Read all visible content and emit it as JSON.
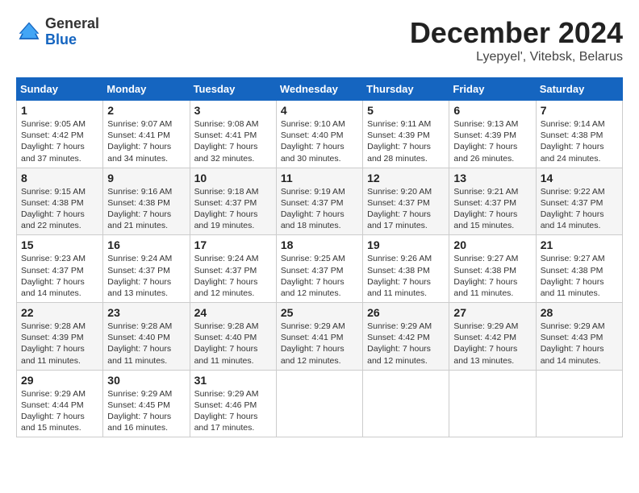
{
  "header": {
    "logo_line1": "General",
    "logo_line2": "Blue",
    "month_title": "December 2024",
    "subtitle": "Lyepyel', Vitebsk, Belarus"
  },
  "days_of_week": [
    "Sunday",
    "Monday",
    "Tuesday",
    "Wednesday",
    "Thursday",
    "Friday",
    "Saturday"
  ],
  "weeks": [
    [
      {
        "day": "1",
        "sunrise": "9:05 AM",
        "sunset": "4:42 PM",
        "daylight": "7 hours and 37 minutes."
      },
      {
        "day": "2",
        "sunrise": "9:07 AM",
        "sunset": "4:41 PM",
        "daylight": "7 hours and 34 minutes."
      },
      {
        "day": "3",
        "sunrise": "9:08 AM",
        "sunset": "4:41 PM",
        "daylight": "7 hours and 32 minutes."
      },
      {
        "day": "4",
        "sunrise": "9:10 AM",
        "sunset": "4:40 PM",
        "daylight": "7 hours and 30 minutes."
      },
      {
        "day": "5",
        "sunrise": "9:11 AM",
        "sunset": "4:39 PM",
        "daylight": "7 hours and 28 minutes."
      },
      {
        "day": "6",
        "sunrise": "9:13 AM",
        "sunset": "4:39 PM",
        "daylight": "7 hours and 26 minutes."
      },
      {
        "day": "7",
        "sunrise": "9:14 AM",
        "sunset": "4:38 PM",
        "daylight": "7 hours and 24 minutes."
      }
    ],
    [
      {
        "day": "8",
        "sunrise": "9:15 AM",
        "sunset": "4:38 PM",
        "daylight": "7 hours and 22 minutes."
      },
      {
        "day": "9",
        "sunrise": "9:16 AM",
        "sunset": "4:38 PM",
        "daylight": "7 hours and 21 minutes."
      },
      {
        "day": "10",
        "sunrise": "9:18 AM",
        "sunset": "4:37 PM",
        "daylight": "7 hours and 19 minutes."
      },
      {
        "day": "11",
        "sunrise": "9:19 AM",
        "sunset": "4:37 PM",
        "daylight": "7 hours and 18 minutes."
      },
      {
        "day": "12",
        "sunrise": "9:20 AM",
        "sunset": "4:37 PM",
        "daylight": "7 hours and 17 minutes."
      },
      {
        "day": "13",
        "sunrise": "9:21 AM",
        "sunset": "4:37 PM",
        "daylight": "7 hours and 15 minutes."
      },
      {
        "day": "14",
        "sunrise": "9:22 AM",
        "sunset": "4:37 PM",
        "daylight": "7 hours and 14 minutes."
      }
    ],
    [
      {
        "day": "15",
        "sunrise": "9:23 AM",
        "sunset": "4:37 PM",
        "daylight": "7 hours and 14 minutes."
      },
      {
        "day": "16",
        "sunrise": "9:24 AM",
        "sunset": "4:37 PM",
        "daylight": "7 hours and 13 minutes."
      },
      {
        "day": "17",
        "sunrise": "9:24 AM",
        "sunset": "4:37 PM",
        "daylight": "7 hours and 12 minutes."
      },
      {
        "day": "18",
        "sunrise": "9:25 AM",
        "sunset": "4:37 PM",
        "daylight": "7 hours and 12 minutes."
      },
      {
        "day": "19",
        "sunrise": "9:26 AM",
        "sunset": "4:38 PM",
        "daylight": "7 hours and 11 minutes."
      },
      {
        "day": "20",
        "sunrise": "9:27 AM",
        "sunset": "4:38 PM",
        "daylight": "7 hours and 11 minutes."
      },
      {
        "day": "21",
        "sunrise": "9:27 AM",
        "sunset": "4:38 PM",
        "daylight": "7 hours and 11 minutes."
      }
    ],
    [
      {
        "day": "22",
        "sunrise": "9:28 AM",
        "sunset": "4:39 PM",
        "daylight": "7 hours and 11 minutes."
      },
      {
        "day": "23",
        "sunrise": "9:28 AM",
        "sunset": "4:40 PM",
        "daylight": "7 hours and 11 minutes."
      },
      {
        "day": "24",
        "sunrise": "9:28 AM",
        "sunset": "4:40 PM",
        "daylight": "7 hours and 11 minutes."
      },
      {
        "day": "25",
        "sunrise": "9:29 AM",
        "sunset": "4:41 PM",
        "daylight": "7 hours and 12 minutes."
      },
      {
        "day": "26",
        "sunrise": "9:29 AM",
        "sunset": "4:42 PM",
        "daylight": "7 hours and 12 minutes."
      },
      {
        "day": "27",
        "sunrise": "9:29 AM",
        "sunset": "4:42 PM",
        "daylight": "7 hours and 13 minutes."
      },
      {
        "day": "28",
        "sunrise": "9:29 AM",
        "sunset": "4:43 PM",
        "daylight": "7 hours and 14 minutes."
      }
    ],
    [
      {
        "day": "29",
        "sunrise": "9:29 AM",
        "sunset": "4:44 PM",
        "daylight": "7 hours and 15 minutes."
      },
      {
        "day": "30",
        "sunrise": "9:29 AM",
        "sunset": "4:45 PM",
        "daylight": "7 hours and 16 minutes."
      },
      {
        "day": "31",
        "sunrise": "9:29 AM",
        "sunset": "4:46 PM",
        "daylight": "7 hours and 17 minutes."
      },
      null,
      null,
      null,
      null
    ]
  ],
  "labels": {
    "sunrise_prefix": "Sunrise: ",
    "sunset_prefix": "Sunset: ",
    "daylight_prefix": "Daylight: "
  }
}
